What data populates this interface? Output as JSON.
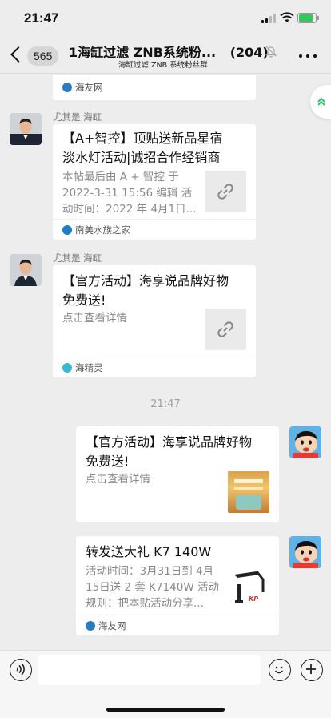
{
  "status_bar": {
    "time": "21:47"
  },
  "nav": {
    "unread_count": "565",
    "title": "1海缸过滤 ZNB系统粉...",
    "member_count": "(204)",
    "subtitle": "海缸过滤 ZNB 系统粉丝群"
  },
  "messages": [
    {
      "type": "link-card-partial",
      "source": "海友网"
    },
    {
      "type": "link-card",
      "sender": "尤其是 海缸",
      "title": [
        "【A+智控】顶贴送新品星宿",
        "淡水灯活动|诚招合作经销商"
      ],
      "desc": [
        "本帖最后由 A + 智控 于",
        "2022-3-31 15:56 编辑 活",
        "动时间：2022 年 4月1日..."
      ],
      "source": "南美水族之家",
      "icon": "link-icon"
    },
    {
      "type": "link-card",
      "sender": "尤其是 海缸",
      "title": [
        "【官方活动】海享说品牌好物",
        "免费送!"
      ],
      "desc": [
        "点击查看详情"
      ],
      "source": "海精灵",
      "icon": "link-icon"
    },
    {
      "type": "timestamp",
      "text": "21:47"
    },
    {
      "type": "link-card-self",
      "title": [
        "【官方活动】海享说品牌好物",
        "免费送!"
      ],
      "desc": [
        "点击查看详情"
      ]
    },
    {
      "type": "link-card-self",
      "title": [
        "转发送大礼 K7 140W"
      ],
      "desc": [
        "活动时间：3月31日到 4月",
        "15日送 2 套 K7140W 活动",
        "规则：把本贴活动分享..."
      ],
      "source": "海友网",
      "thumb_label": "KP"
    }
  ],
  "input": {
    "placeholder": ""
  },
  "colors": {
    "background": "#ededed",
    "card": "#ffffff",
    "accent_green": "#07c160",
    "battery": "#34c759"
  }
}
